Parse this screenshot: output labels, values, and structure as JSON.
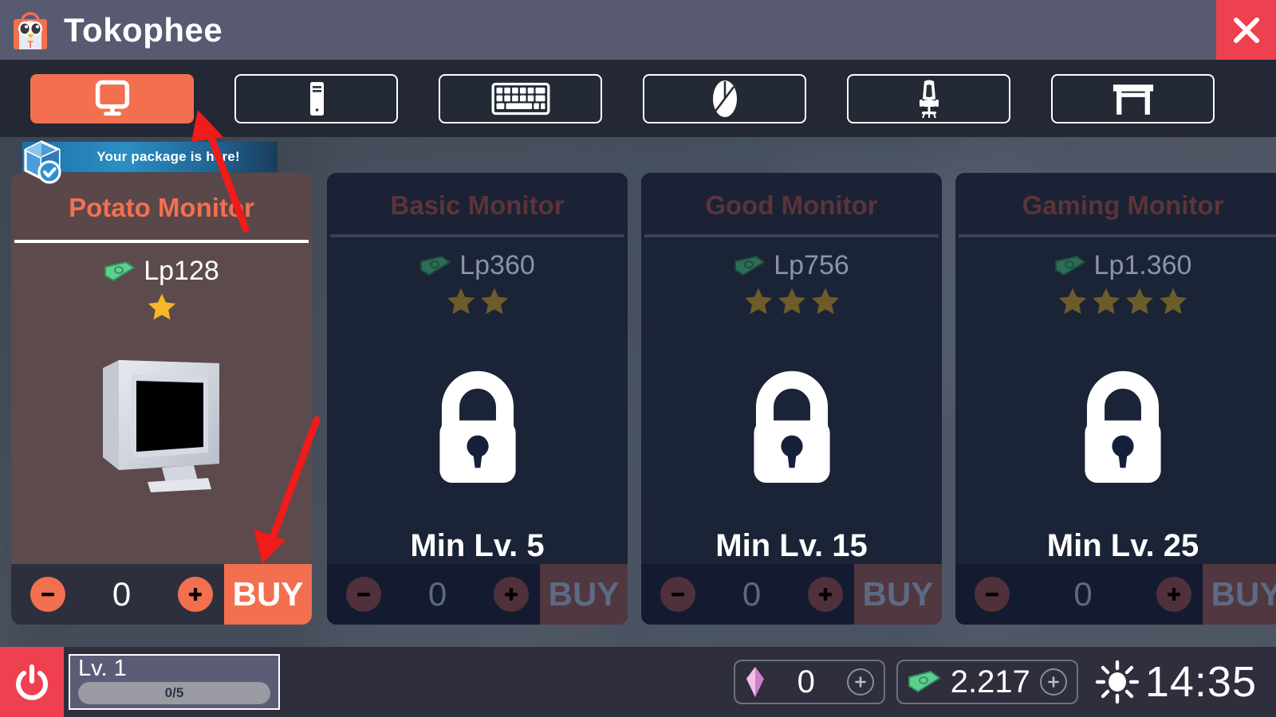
{
  "header": {
    "title": "Tokophee",
    "logo_icon": "shop-bag-penguin-logo",
    "close_icon": "close-icon"
  },
  "tabs": [
    {
      "id": "monitor",
      "icon": "monitor-icon",
      "active": true
    },
    {
      "id": "pc-tower",
      "icon": "pc-tower-icon",
      "active": false
    },
    {
      "id": "keyboard",
      "icon": "keyboard-icon",
      "active": false
    },
    {
      "id": "mouse",
      "icon": "mouse-icon",
      "active": false
    },
    {
      "id": "chair",
      "icon": "gaming-chair-icon",
      "active": false
    },
    {
      "id": "desk",
      "icon": "desk-icon",
      "active": false
    }
  ],
  "package_badge": {
    "text": "Your package is here!",
    "icon": "package-delivered-icon"
  },
  "cards": [
    {
      "id": "potato-monitor",
      "title": "Potato Monitor",
      "price": "Lp128",
      "stars": 1,
      "locked": false,
      "quantity": "0",
      "buy_label": "BUY",
      "minus_label": "−",
      "plus_label": "+",
      "art_icon": "crt-monitor-art"
    },
    {
      "id": "basic-monitor",
      "title": "Basic Monitor",
      "price": "Lp360",
      "stars": 2,
      "locked": true,
      "lock_text": "Min Lv. 5",
      "quantity": "0",
      "buy_label": "BUY",
      "minus_label": "−",
      "plus_label": "+",
      "art_icon": "lock-icon"
    },
    {
      "id": "good-monitor",
      "title": "Good Monitor",
      "price": "Lp756",
      "stars": 3,
      "locked": true,
      "lock_text": "Min Lv. 15",
      "quantity": "0",
      "buy_label": "BUY",
      "minus_label": "−",
      "plus_label": "+",
      "art_icon": "lock-icon"
    },
    {
      "id": "gaming-monitor",
      "title": "Gaming Monitor",
      "price": "Lp1.360",
      "stars": 4,
      "locked": true,
      "lock_text": "Min Lv. 25",
      "quantity": "0",
      "buy_label": "BUY",
      "minus_label": "−",
      "plus_label": "+",
      "art_icon": "lock-icon"
    }
  ],
  "bottom": {
    "power_icon": "power-icon",
    "level_label": "Lv. 1",
    "level_progress": "0/5",
    "gem": {
      "icon": "gem-icon",
      "value": "0",
      "plus_icon": "plus-icon"
    },
    "cash": {
      "icon": "cash-icon",
      "value": "2.217",
      "plus_icon": "plus-icon"
    },
    "weather_icon": "sun-icon",
    "time": "14:35"
  },
  "colors": {
    "accent": "#f2704f",
    "header_bg": "#585a72",
    "close_red": "#ef4050",
    "tabbar_bg": "#232834",
    "card_unlocked_bg": "#5c4a4d",
    "card_locked_bg": "#1b2133",
    "star_gold": "#f5b826",
    "star_locked": "#6b5c2a",
    "bottom_bg": "#2e2e3c",
    "annotation_red": "#f01b1b"
  },
  "annotations": [
    {
      "id": "arrow-to-monitor-tab",
      "points_to": "monitor tab"
    },
    {
      "id": "arrow-to-buy-button",
      "points_to": "BUY button"
    }
  ]
}
